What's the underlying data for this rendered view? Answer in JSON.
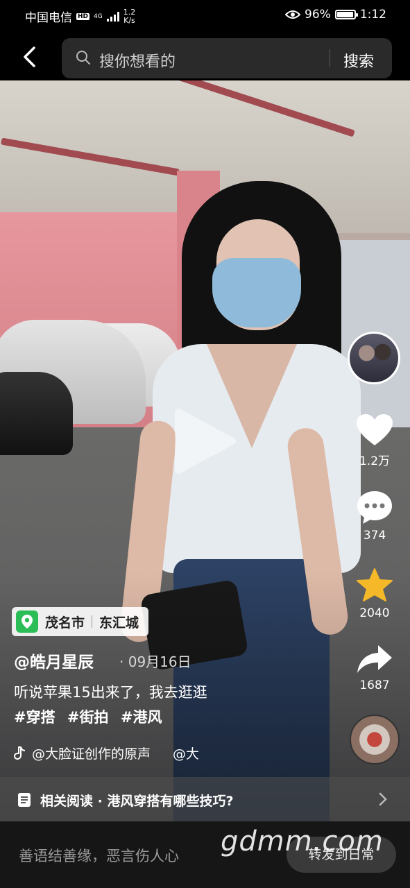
{
  "status_bar": {
    "carrier": "中国电信",
    "hd": "HD",
    "network": "4G",
    "speed": "1.2\nK/s",
    "speed_top": "1.2",
    "speed_bottom": "K/s",
    "battery": "96%",
    "battery_level": 0.96,
    "time": "1:12"
  },
  "search": {
    "placeholder": "搜你想看的",
    "button": "搜索"
  },
  "sidebar": {
    "likes": "1.2万",
    "comments": "374",
    "favorites": "2040",
    "shares": "1687"
  },
  "post": {
    "location_city": "茂名市",
    "location_place": "东汇城",
    "author": "@皓月星辰",
    "date": "· 09月16日",
    "caption": "听说苹果15出来了，我去逛逛",
    "tags": [
      "#穿搭",
      "#街拍",
      "#港风"
    ],
    "music": "@大脸证创作的原声",
    "music_extra": "@大"
  },
  "related": {
    "text": "相关阅读 · 港风穿搭有哪些技巧?"
  },
  "bottom": {
    "hint": "善语结善缘，恶言伤人心",
    "share_button": "转发到日常"
  },
  "watermark": "gdmm.com",
  "icons": {
    "back": "back-arrow-icon",
    "search": "search-icon",
    "like": "heart-icon",
    "comment": "comment-icon",
    "favorite": "star-icon",
    "share": "share-arrow-icon"
  },
  "colors": {
    "favorite_star": "#f5b829",
    "location_pin": "#2bbd56"
  }
}
